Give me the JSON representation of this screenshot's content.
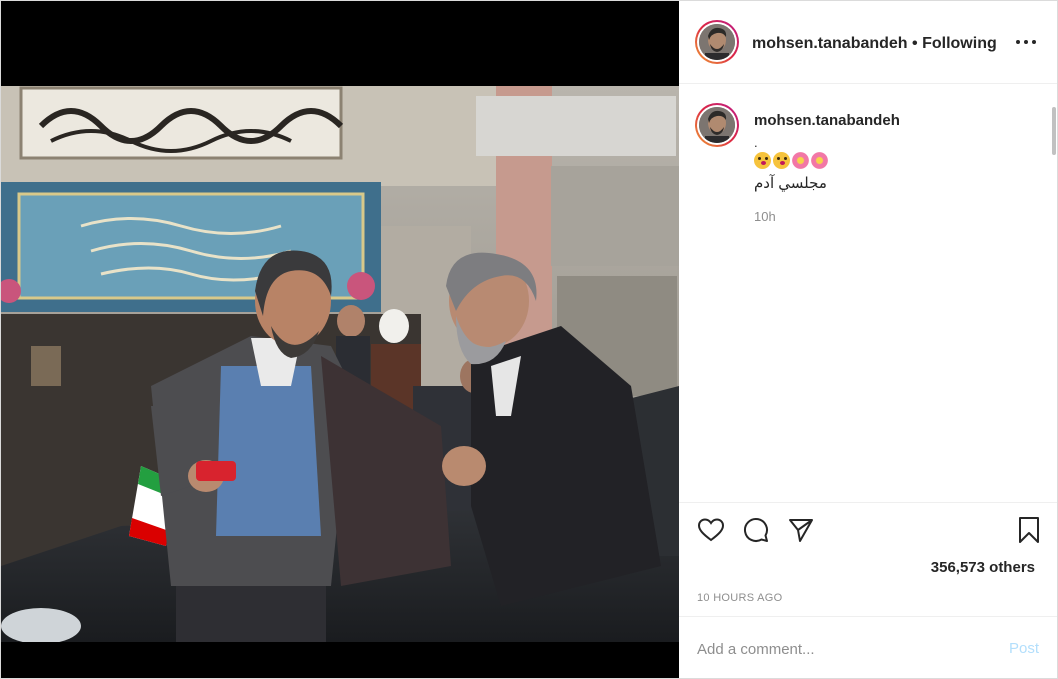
{
  "header": {
    "username": "mohsen.tanabandeh",
    "separator": "•",
    "follow_status": "Following",
    "more_icon": "more-horizontal-icon"
  },
  "caption": {
    "username": "mohsen.tanabandeh",
    "line1": ".",
    "emojis": [
      "face-blowing-kiss-emoji",
      "face-blowing-kiss-emoji",
      "cherry-blossom-emoji",
      "cherry-blossom-emoji"
    ],
    "text": "مجلسي آدم",
    "time": "10h"
  },
  "actions": {
    "like_icon": "heart-icon",
    "comment_icon": "comment-icon",
    "share_icon": "paper-plane-icon",
    "save_icon": "bookmark-icon",
    "likes_text": "356,573 others",
    "timestamp": "10 HOURS AGO"
  },
  "comment": {
    "placeholder": "Add a comment...",
    "post_label": "Post"
  },
  "colors": {
    "post_button_disabled": "#b3dffc",
    "secondary_text": "#8e8e8e",
    "border": "#dbdbdb"
  }
}
